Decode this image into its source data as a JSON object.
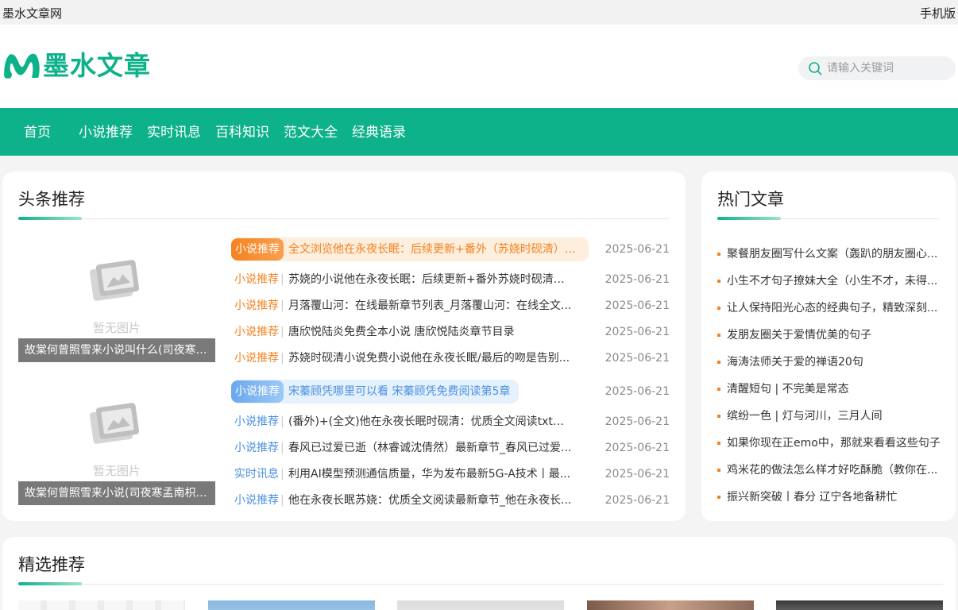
{
  "topbar": {
    "site_name": "墨水文章网",
    "mobile_label": "手机版"
  },
  "header": {
    "logo_text": "墨水文章",
    "search_placeholder": "请输入关键词",
    "brand_color": "#0db18a"
  },
  "nav": {
    "items": [
      "首页",
      "小说推荐",
      "实时讯息",
      "百科知识",
      "范文大全",
      "经典语录"
    ]
  },
  "headline": {
    "title": "头条推荐",
    "placeholder_text": "暂无图片",
    "groups": [
      {
        "caption": "故棠何曾照雪来小说叫什么(司夜寒孟...",
        "featured": {
          "tag": "小说推荐",
          "title": "全文浏览他在永夜长眠：后续更新+番外（苏娆时砚清）_...",
          "date": "2025-06-21",
          "color": "#f58220"
        },
        "items": [
          {
            "tag": "小说推荐",
            "title": "苏娆的小说他在永夜长眠：后续更新+番外苏娆时砚清全...",
            "date": "2025-06-21"
          },
          {
            "tag": "小说推荐",
            "title": "月落覆山河：在线最新章节列表_月落覆山河：在线全文...",
            "date": "2025-06-21"
          },
          {
            "tag": "小说推荐",
            "title": "唐欣悦陆炎免费全本小说 唐欣悦陆炎章节目录",
            "date": "2025-06-21"
          },
          {
            "tag": "小说推荐",
            "title": "苏娆时砚清小说免费小说他在永夜长眠/最后的吻是告别...",
            "date": "2025-06-21"
          }
        ]
      },
      {
        "caption": "故棠何曾照雪来小说(司夜寒孟南枳)+...",
        "featured": {
          "tag": "小说推荐",
          "title": "宋蓁顾凭哪里可以看 宋蓁顾凭免费阅读第5章",
          "date": "2025-06-21",
          "color": "#4a90e2"
        },
        "items": [
          {
            "tag": "小说推荐",
            "title": "(番外)+(全文)他在永夜长眠时砚清：优质全文阅读txt下...",
            "date": "2025-06-21"
          },
          {
            "tag": "小说推荐",
            "title": "春风已过爱已逝（林睿诚沈倩然）最新章节_春风已过爱...",
            "date": "2025-06-21"
          },
          {
            "tag": "实时讯息",
            "title": "利用AI模型预测通信质量，华为发布最新5G-A技术丨最...",
            "date": "2025-06-21"
          },
          {
            "tag": "小说推荐",
            "title": "他在永夜长眠苏娆：优质全文阅读最新章节_他在永夜长...",
            "date": "2025-06-21"
          }
        ]
      }
    ]
  },
  "hot": {
    "title": "热门文章",
    "items": [
      "聚餐朋友圈写什么文案（轰趴的朋友圈心...",
      "小生不才句子撩妹大全（小生不才，未得...",
      "让人保持阳光心态的经典句子，精致深刻...",
      "发朋友圈关于爱情优美的句子",
      "海涛法师关于爱的禅语20句",
      "清醒短句 | 不完美是常态",
      "缤纷一色 | 灯与河川，三月人间",
      "如果你现在正emo中，那就来看看这些句子",
      "鸡米花的做法怎么样才好吃酥脆（教你在...",
      "振兴新突破丨春分 辽宁各地备耕忙"
    ]
  },
  "feature": {
    "title": "精选推荐"
  }
}
